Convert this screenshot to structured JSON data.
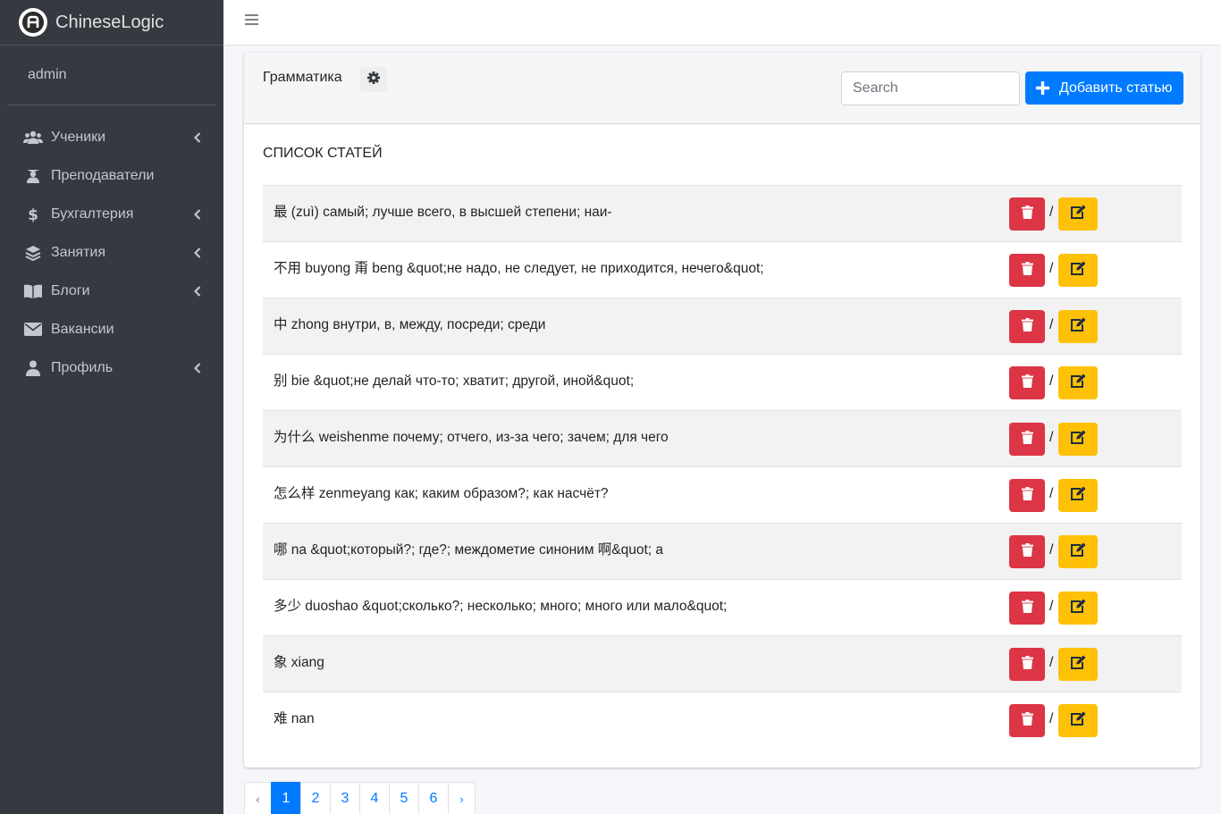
{
  "brand": {
    "name": "ChineseLogic"
  },
  "user": {
    "name": "admin"
  },
  "sidebar": {
    "items": [
      {
        "label": "Ученики",
        "icon": "users-icon",
        "has_submenu": true
      },
      {
        "label": "Преподаватели",
        "icon": "graduation-icon",
        "has_submenu": false
      },
      {
        "label": "Бухгалтерия",
        "icon": "dollar-icon",
        "has_submenu": true
      },
      {
        "label": "Занятия",
        "icon": "layers-icon",
        "has_submenu": true
      },
      {
        "label": "Блоги",
        "icon": "book-icon",
        "has_submenu": true
      },
      {
        "label": "Вакансии",
        "icon": "envelope-icon",
        "has_submenu": false
      },
      {
        "label": "Профиль",
        "icon": "user-icon",
        "has_submenu": true
      }
    ]
  },
  "card": {
    "title": "Грамматика",
    "search_placeholder": "Search",
    "add_label": "Добавить статью",
    "list_title": "СПИСОК СТАТЕЙ",
    "separator": "/",
    "articles": [
      "最 (zuì) самый; лучше всего, в высшей степени; наи-",
      "不用 buyong 甭 beng &quot;не надо, не следует, не приходится, нечего&quot;",
      "中 zhong внутри, в, между, посреди; среди",
      "别 bie &quot;не делай что-то; хватит; другой, иной&quot;",
      "为什么 weishenme почему; отчего, из-за чего; зачем; для чего",
      "怎么样 zenmeyang как; каким образом?; как насчёт?",
      "哪 na &quot;который?; где?; междометие синоним 啊&quot; а",
      "多少 duoshao &quot;сколько?; несколько; много; много или мало&quot;",
      "象 xiang",
      "难 nan"
    ]
  },
  "pagination": {
    "prev": "‹",
    "next": "›",
    "pages": [
      "1",
      "2",
      "3",
      "4",
      "5",
      "6"
    ],
    "active": "1"
  },
  "colors": {
    "sidebar_bg": "#343a40",
    "primary": "#007bff",
    "danger": "#dc3545",
    "warning": "#ffc107"
  }
}
